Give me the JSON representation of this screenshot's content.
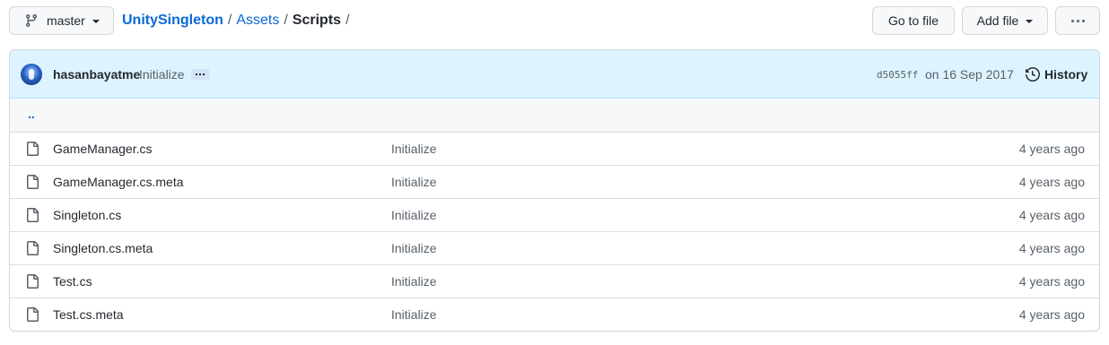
{
  "branch": {
    "name": "master",
    "icon": "git-branch-icon"
  },
  "breadcrumb": {
    "repo": "UnitySingleton",
    "sep1": "/",
    "folder": "Assets",
    "sep2": "/",
    "current": "Scripts",
    "sep3": "/"
  },
  "actions": {
    "goto_file": "Go to file",
    "add_file": "Add file"
  },
  "commit": {
    "author": "hasanbayatme",
    "message": "Initialize",
    "sha": "d5055ff",
    "date": "on 16 Sep 2017",
    "history_label": "History"
  },
  "updir": "..",
  "files": [
    {
      "name": "GameManager.cs",
      "message": "Initialize",
      "age": "4 years ago"
    },
    {
      "name": "GameManager.cs.meta",
      "message": "Initialize",
      "age": "4 years ago"
    },
    {
      "name": "Singleton.cs",
      "message": "Initialize",
      "age": "4 years ago"
    },
    {
      "name": "Singleton.cs.meta",
      "message": "Initialize",
      "age": "4 years ago"
    },
    {
      "name": "Test.cs",
      "message": "Initialize",
      "age": "4 years ago"
    },
    {
      "name": "Test.cs.meta",
      "message": "Initialize",
      "age": "4 years ago"
    }
  ],
  "colors": {
    "link": "#0969da",
    "commit_bar_bg": "#ddf4ff",
    "border": "#d0d7de",
    "muted": "#57606a"
  }
}
